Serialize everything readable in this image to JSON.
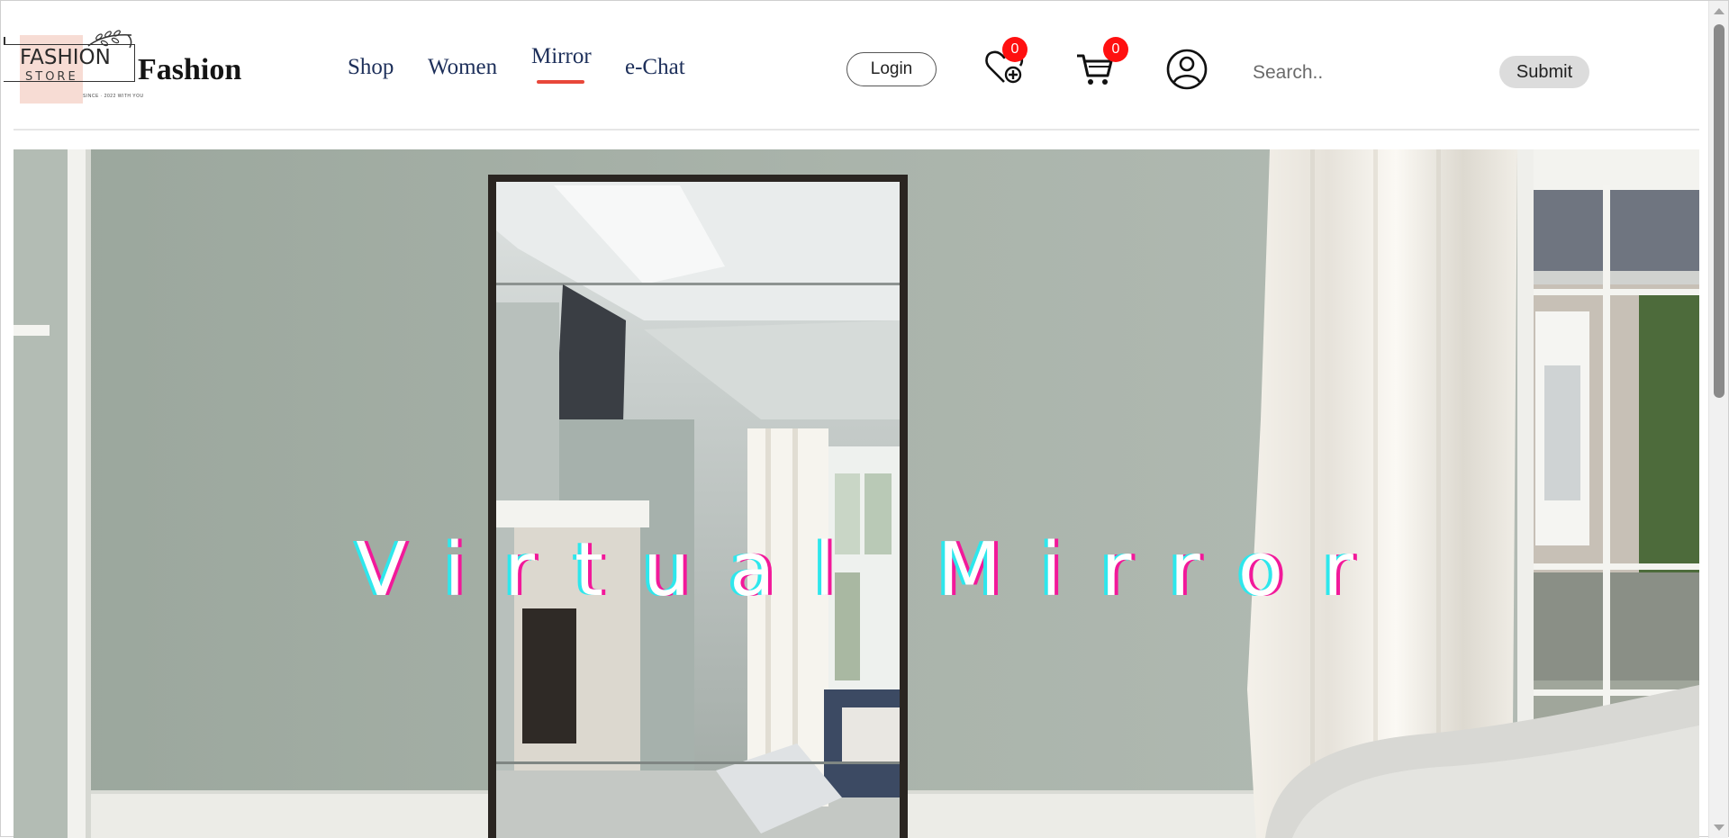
{
  "brand": {
    "logo_line1": "FASHION",
    "logo_line2": "STORE",
    "logo_tagline": "SINCE · 2022 WITH YOU",
    "name": "Fashion"
  },
  "nav": {
    "items": [
      {
        "label": "Shop"
      },
      {
        "label": "Women"
      },
      {
        "label": "Mirror",
        "active": true
      },
      {
        "label": "e-Chat"
      }
    ],
    "active_underline_color": "#e8473a"
  },
  "header": {
    "login_label": "Login",
    "wishlist_count": "0",
    "cart_count": "0",
    "badge_color": "#ff1010",
    "search_placeholder": "Search..",
    "submit_label": "Submit"
  },
  "hero": {
    "title": "Virtual Mirror",
    "title_glitch_colors": [
      "#2ee7ec",
      "#f2199a"
    ]
  }
}
